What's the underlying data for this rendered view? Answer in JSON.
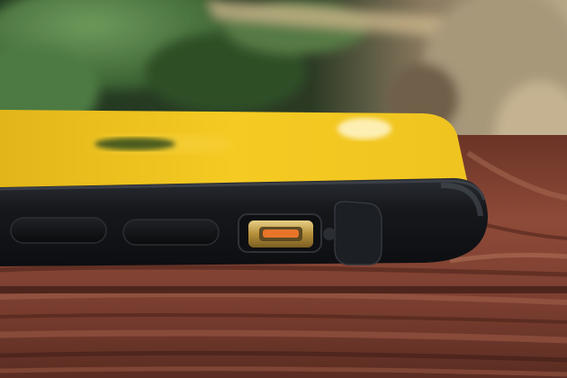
{
  "photo": {
    "subject": "",
    "colors": {
      "phone_back": "#f2c51c",
      "case": "#15171b",
      "button_accent": "#c9a24a",
      "switch_orange": "#e8742a",
      "wood": "#8a4a36",
      "foliage": "#3f6b3a",
      "background_dark": "#1e2418"
    }
  }
}
